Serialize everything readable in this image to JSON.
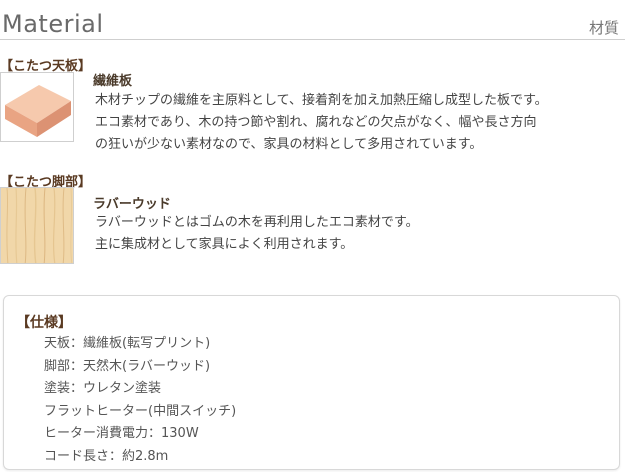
{
  "header": {
    "title": "Material",
    "subtitle": "材質"
  },
  "sections": [
    {
      "label": "【こたつ天板】",
      "image_icon": "fiberboard-thumbnail",
      "name": "繊維板",
      "lines": [
        "木材チップの繊維を主原料として、接着剤を加え加熱圧縮し成型した板です。",
        "エコ素材であり、木の持つ節や割れ、腐れなどの欠点がなく、幅や長さ方向",
        "の狂いが少ない素材なので、家具の材料として多用されています。"
      ]
    },
    {
      "label": "【こたつ脚部】",
      "image_icon": "rubberwood-thumbnail",
      "name": "ラバーウッド",
      "lines": [
        "ラバーウッドとはゴムの木を再利用したエコ素材です。",
        "主に集成材として家具によく利用されます。"
      ]
    }
  ],
  "spec": {
    "title": "【仕様】",
    "items": [
      "天板：繊維板(転写プリント)",
      "脚部：天然木(ラバーウッド)",
      "塗装：ウレタン塗装",
      "フラットヒーター(中間スイッチ)",
      "ヒーター消費電力：130W",
      "コード長さ：約2.8m"
    ]
  },
  "colors": {
    "label": "#5a3a22",
    "rule": "#cfcfcf",
    "board": "#f2b89a",
    "wood": "#f0d7a8"
  }
}
